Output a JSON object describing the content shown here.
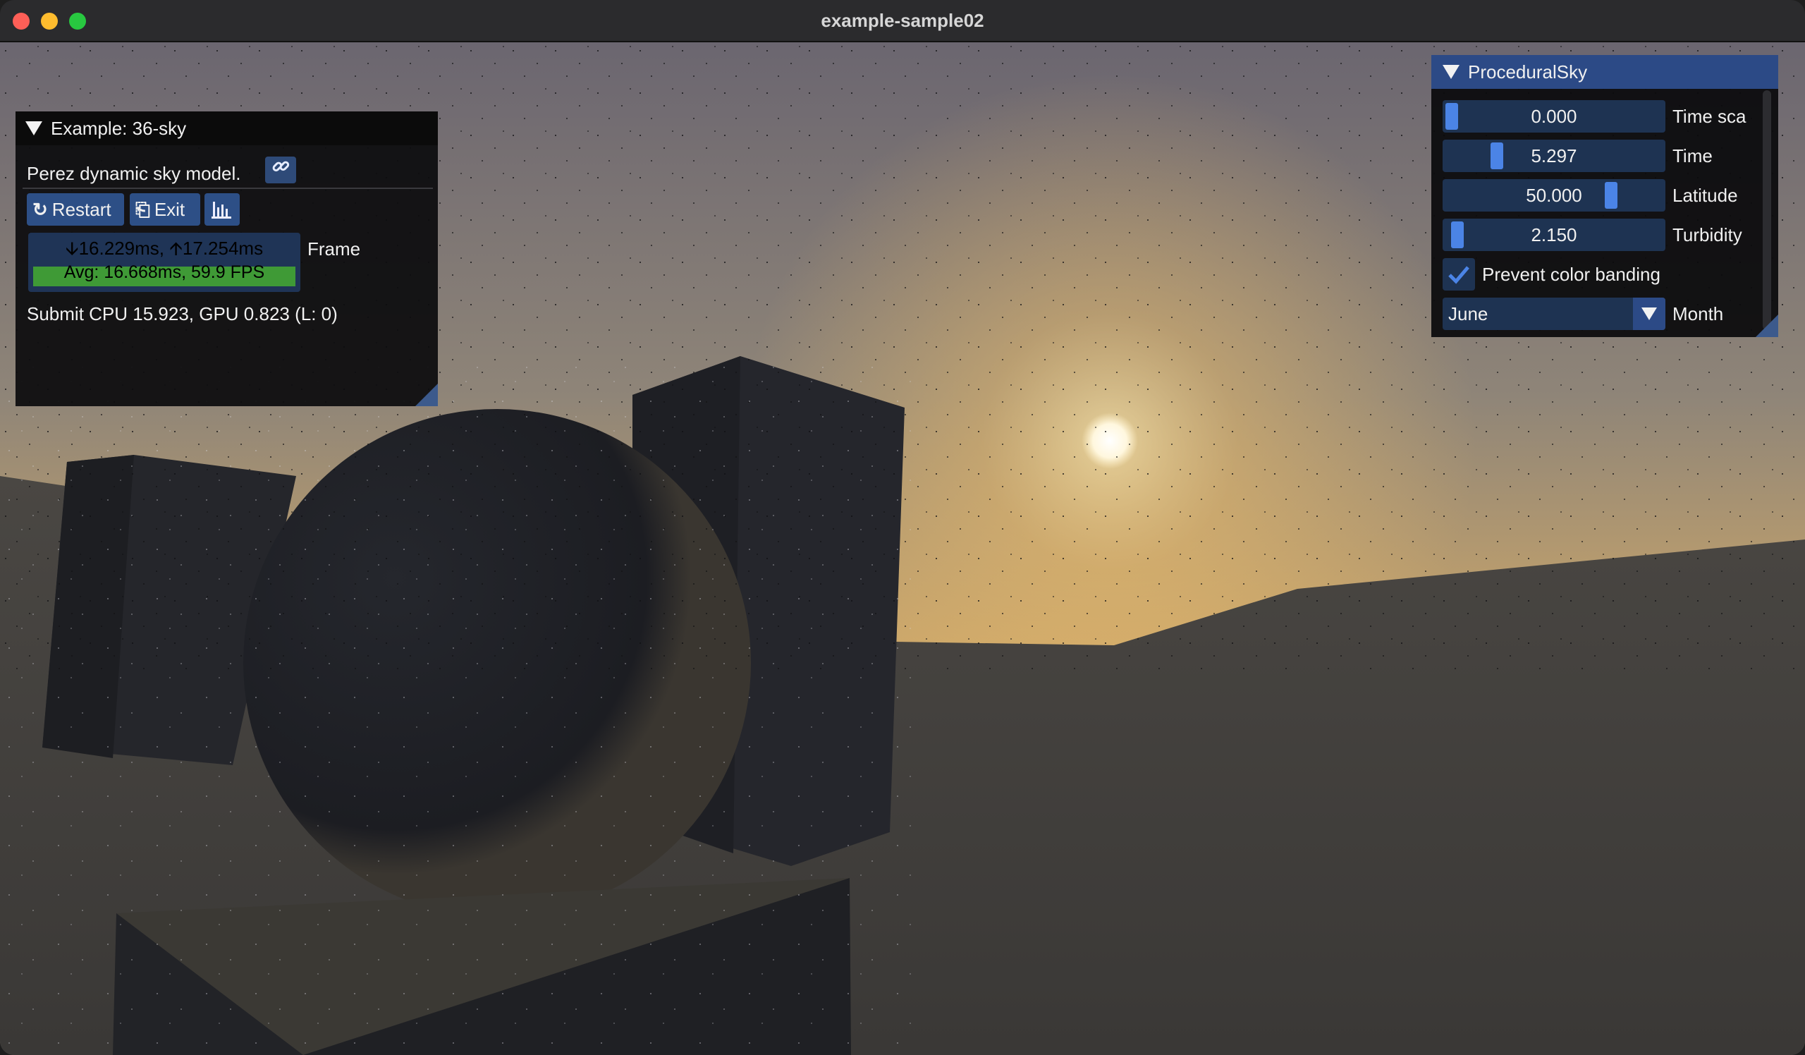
{
  "window": {
    "title": "example-sample02"
  },
  "example_panel": {
    "title": "Example: 36-sky",
    "description": "Perez dynamic sky model.",
    "link_icon": "link-icon",
    "buttons": [
      {
        "icon": "restart-icon",
        "label": "Restart"
      },
      {
        "icon": "exit-icon",
        "label": "Exit"
      },
      {
        "icon": "chart-icon",
        "label": ""
      }
    ],
    "frame": {
      "line1": "🡫16.229ms, 🡩17.254ms",
      "line2": "Avg: 16.668ms, 59.9 FPS",
      "label": "Frame"
    },
    "submit": "Submit CPU 15.923, GPU 0.823 (L: 0)"
  },
  "sky_panel": {
    "title": "ProceduralSky",
    "sliders": [
      {
        "value": "0.000",
        "label": "Time sca"
      },
      {
        "value": "5.297",
        "label": "Time"
      },
      {
        "value": "50.000",
        "label": "Latitude"
      },
      {
        "value": "2.150",
        "label": "Turbidity"
      }
    ],
    "checkbox": {
      "label": "Prevent color banding",
      "checked": true
    },
    "combo": {
      "value": "June",
      "label": "Month"
    }
  },
  "colors": {
    "accent": "#2c4a86",
    "grab": "#4b84e6",
    "frame_bar": "#3f9a36"
  }
}
